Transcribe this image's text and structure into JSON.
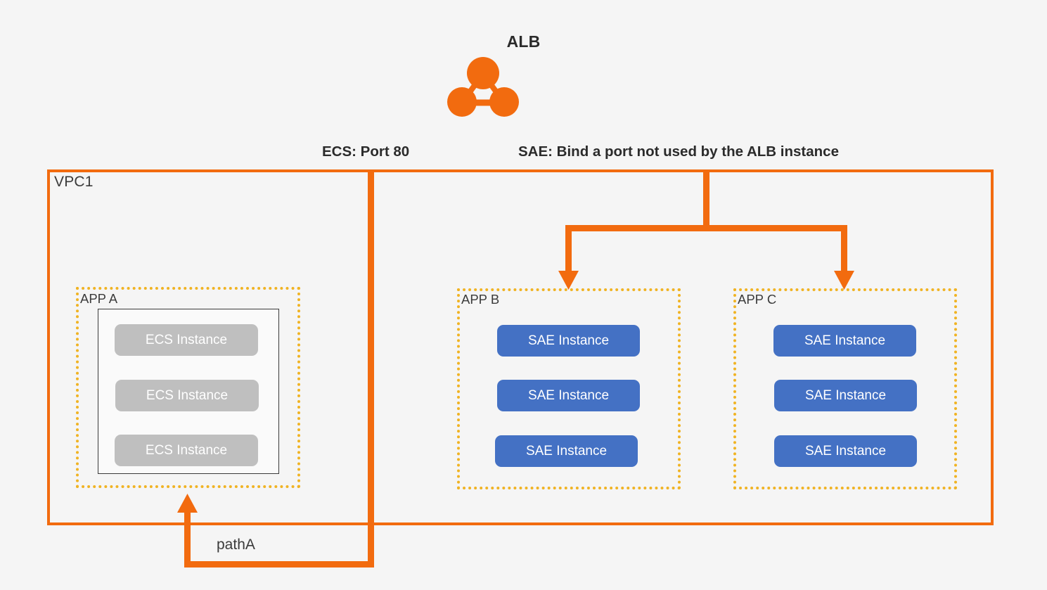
{
  "diagram": {
    "alb": {
      "title": "ALB",
      "icon": "alb-network-icon"
    },
    "captions": {
      "ecs": "ECS: Port 80",
      "sae": "SAE: Bind a port not used by the ALB instance"
    },
    "vpc": {
      "label": "VPC1"
    },
    "path": {
      "label": "pathA"
    },
    "groups": [
      {
        "label": "APP A",
        "kind": "ecs",
        "instances": [
          {
            "label": "ECS Instance"
          },
          {
            "label": "ECS Instance"
          },
          {
            "label": "ECS Instance"
          }
        ]
      },
      {
        "label": "APP B",
        "kind": "sae",
        "instances": [
          {
            "label": "SAE Instance"
          },
          {
            "label": "SAE Instance"
          },
          {
            "label": "SAE Instance"
          }
        ]
      },
      {
        "label": "APP C",
        "kind": "sae",
        "instances": [
          {
            "label": "SAE Instance"
          },
          {
            "label": "SAE Instance"
          },
          {
            "label": "SAE Instance"
          }
        ]
      }
    ],
    "colors": {
      "orange": "#F26B0F",
      "amber_dotted": "#F0B323",
      "sae_blue": "#4471C4",
      "ecs_gray": "#BFBFBF",
      "background": "#f5f5f5",
      "text": "#3b3b3b"
    }
  }
}
